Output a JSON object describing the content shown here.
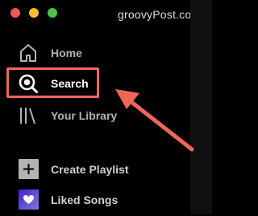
{
  "window": {
    "controls": [
      {
        "name": "close",
        "color": "#ee5a52"
      },
      {
        "name": "minimize",
        "color": "#f5bd2f"
      },
      {
        "name": "maximize",
        "color": "#52c34a"
      }
    ]
  },
  "watermark": "groovyPost.com",
  "nav": {
    "home": {
      "label": "Home",
      "icon": "home-icon"
    },
    "search": {
      "label": "Search",
      "icon": "search-icon"
    },
    "library": {
      "label": "Your Library",
      "icon": "library-icon"
    }
  },
  "playlists": {
    "create": {
      "label": "Create Playlist",
      "icon": "plus-icon"
    },
    "liked": {
      "label": "Liked Songs",
      "icon": "heart-icon"
    }
  },
  "annotation": {
    "color": "#f0665a",
    "highlighted_item": "Search"
  }
}
